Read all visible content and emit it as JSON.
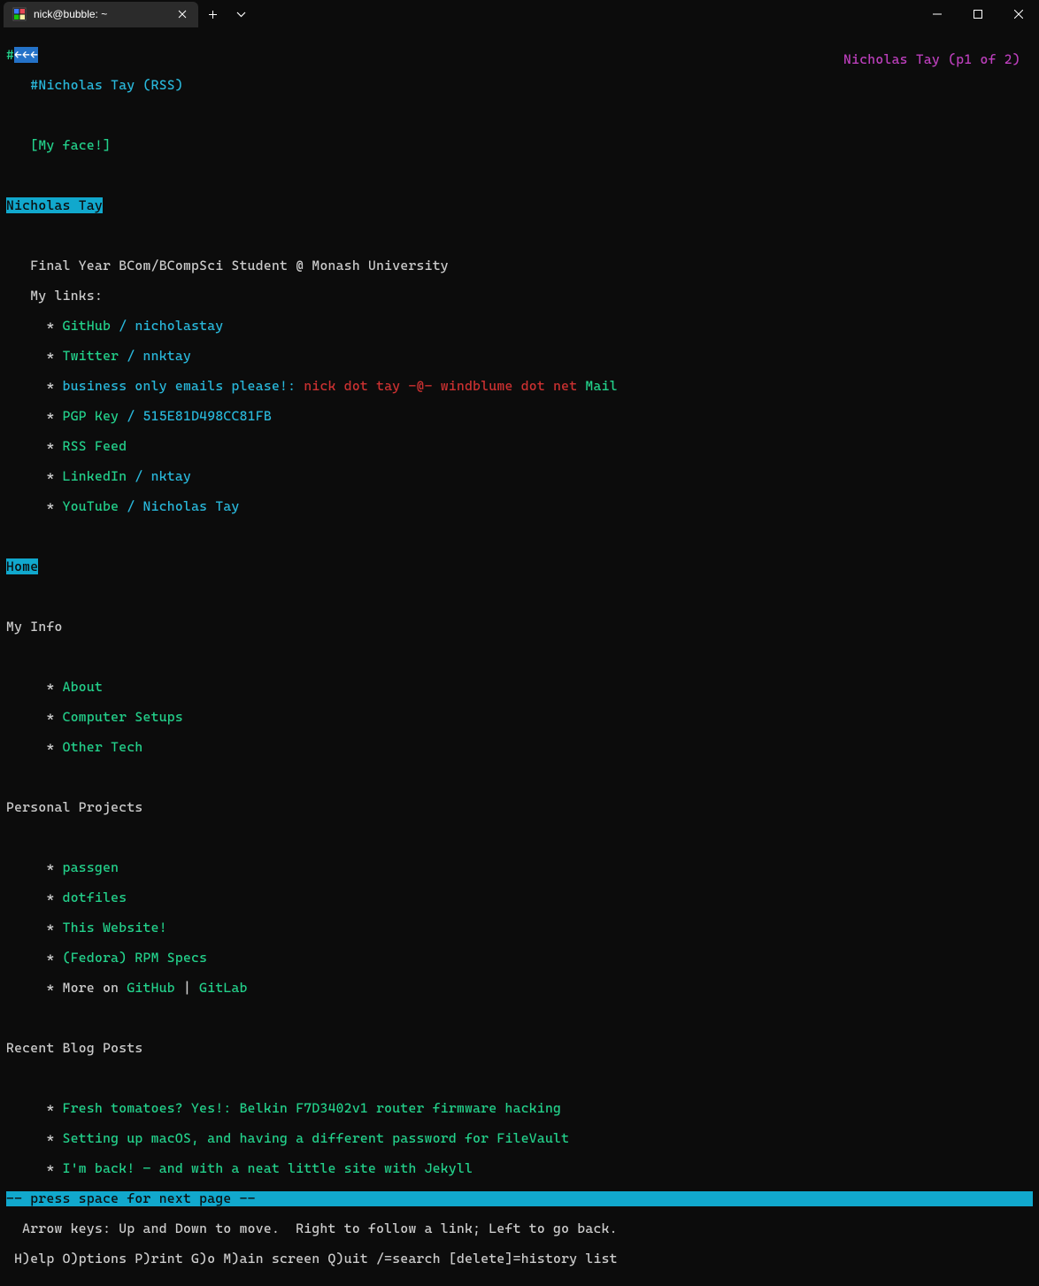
{
  "titlebar": {
    "tab_title": "nick@bubble: ~"
  },
  "header": {
    "prompt_hash": "#",
    "arrows": "←←←",
    "page_indicator": "Nicholas Tay (p1 of 2)",
    "title_line": "#Nicholas Tay (RSS)",
    "face_link": "[My face!]"
  },
  "name_heading": "Nicholas Tay",
  "intro": {
    "line1": "   Final Year BCom/BCompSci Student @ Monash University",
    "line2": "   My links:"
  },
  "links": [
    {
      "bullet": "     * ",
      "label": "GitHub",
      "sep": " / ",
      "handle": "nicholastay"
    },
    {
      "bullet": "     * ",
      "label": "Twitter",
      "sep": " / ",
      "handle": "nnktay"
    },
    {
      "bullet": "     * ",
      "label": "business only emails please!",
      "sep": ": ",
      "email_text": "nick dot tay -@- windblume dot net",
      "mail": " Mail"
    },
    {
      "bullet": "     * ",
      "label": "PGP Key",
      "sep": " / ",
      "handle": "515E81D498CC81FB"
    },
    {
      "bullet": "     * ",
      "label": "RSS Feed"
    },
    {
      "bullet": "     * ",
      "label": "LinkedIn",
      "sep": " / ",
      "handle": "nktay"
    },
    {
      "bullet": "     * ",
      "label": "YouTube",
      "sep": " / ",
      "handle": "Nicholas Tay"
    }
  ],
  "home_heading": "Home",
  "sections": {
    "myinfo": {
      "title": "My Info",
      "items": [
        "About",
        "Computer Setups",
        "Other Tech"
      ]
    },
    "projects": {
      "title": "Personal Projects",
      "items": [
        "passgen",
        "dotfiles",
        "This Website!",
        "(Fedora) RPM Specs"
      ],
      "more_line": {
        "prefix": "More on ",
        "github": "GitHub",
        "pipe": " | ",
        "gitlab": "GitLab"
      }
    },
    "blog": {
      "title": "Recent Blog Posts",
      "items": [
        "Fresh tomatoes? Yes!: Belkin F7D3402v1 router firmware hacking",
        "Setting up macOS, and having a different password for FileVault",
        "I'm back! – and with a neat little site with Jekyll"
      ]
    }
  },
  "footer": {
    "press_space": "-- press space for next page --",
    "help1": "  Arrow keys: Up and Down to move.  Right to follow a link; Left to go back.",
    "help2": " H)elp O)ptions P)rint G)o M)ain screen Q)uit /=search [delete]=history list"
  }
}
